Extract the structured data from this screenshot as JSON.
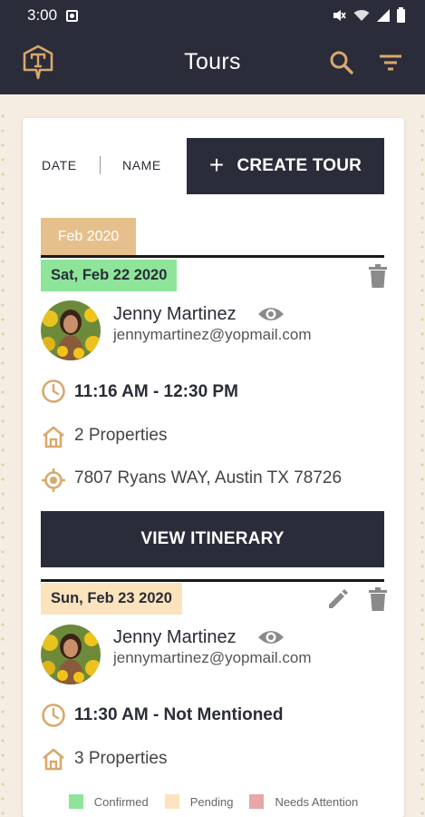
{
  "status_bar": {
    "time": "3:00"
  },
  "app_bar": {
    "title": "Tours",
    "logo_letter": "T",
    "icons": [
      "logo-icon",
      "search-icon",
      "filter-icon"
    ]
  },
  "sort": {
    "date_label": "DATE",
    "name_label": "NAME"
  },
  "create_button": {
    "label": "CREATE TOUR"
  },
  "month_header": "Feb 2020",
  "tours": [
    {
      "date": "Sat, Feb 22 2020",
      "status": "confirmed",
      "client_name": "Jenny Martinez",
      "client_email": "jennymartinez@yopmail.com",
      "time": "11:16 AM - 12:30 PM",
      "properties": "2 Properties",
      "address": "7807 Ryans WAY, Austin TX 78726",
      "action_label": "VIEW ITINERARY"
    },
    {
      "date": "Sun, Feb 23 2020",
      "status": "pending",
      "client_name": "Jenny Martinez",
      "client_email": "jennymartinez@yopmail.com",
      "time": "11:30 AM - Not Mentioned",
      "properties": "3 Properties"
    }
  ],
  "legend": [
    {
      "label": "Confirmed",
      "color": "#8ee59a"
    },
    {
      "label": "Pending",
      "color": "#fbe3bd"
    },
    {
      "label": "Needs Attention",
      "color": "#e7a7a7"
    }
  ],
  "colors": {
    "header_bg": "#2a2c3a",
    "accent": "#d9a86c",
    "page_bg": "#f5ede2"
  }
}
